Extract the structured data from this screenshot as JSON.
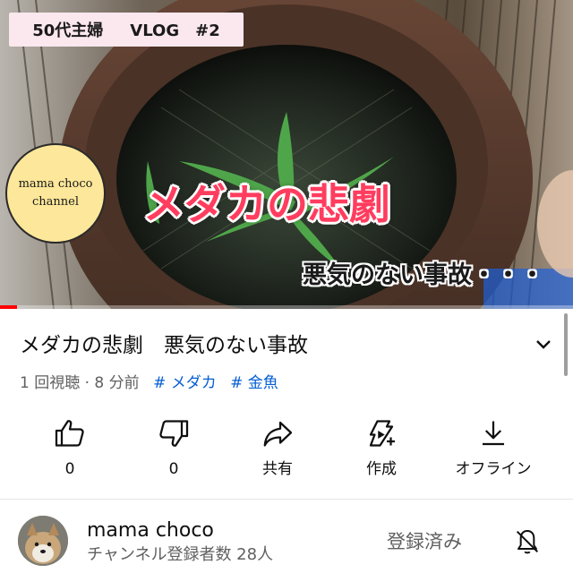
{
  "video": {
    "badge_left": "50代主婦",
    "badge_right": "VLOG　#2",
    "logo_line1": "mama choco",
    "logo_line2": "channel",
    "caption_main": "メダカの悲劇",
    "caption_sub": "悪気のない事故・・・",
    "progress_fraction": 0.03
  },
  "title": "メダカの悲劇　悪気のない事故",
  "meta": {
    "views_time": "1 回視聴 · 8 分前",
    "tags": [
      "# メダカ",
      "# 金魚"
    ]
  },
  "actions": {
    "like": "0",
    "dislike": "0",
    "share": "共有",
    "create": "作成",
    "offline": "オフライン"
  },
  "channel": {
    "name": "mama choco",
    "subscribers": "チャンネル登録者数 28人",
    "subscribed_label": "登録済み"
  },
  "icons": {
    "expand": "chevron-down-icon",
    "like": "thumbs-up-icon",
    "dislike": "thumbs-down-icon",
    "share": "share-arrow-icon",
    "create": "create-sparkle-icon",
    "offline": "download-icon",
    "notifications": "bell-off-icon"
  },
  "colors": {
    "progress": "#ff0000",
    "tag_link": "#065fd4",
    "caption_red": "#ff3d5f",
    "logo_yellow": "#fde79a"
  }
}
